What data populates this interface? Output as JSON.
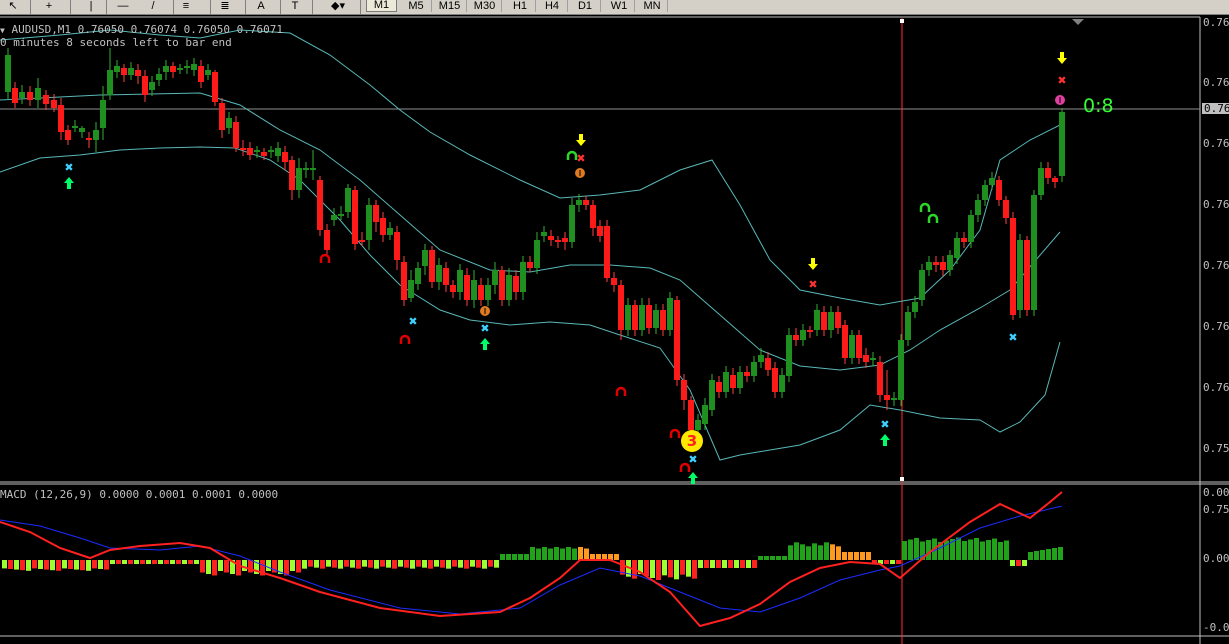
{
  "toolbar": {
    "tools": [
      {
        "name": "cursor-icon",
        "glyph": "↖"
      },
      {
        "name": "crosshair-icon",
        "glyph": "+"
      },
      {
        "name": "vertical-line-icon",
        "glyph": "|"
      },
      {
        "name": "horizontal-line-icon",
        "glyph": "—"
      },
      {
        "name": "trendline-icon",
        "glyph": "/"
      },
      {
        "name": "equidistant-channel-icon",
        "glyph": "≡"
      },
      {
        "name": "fibonacci-icon",
        "glyph": "≣"
      },
      {
        "name": "text-icon",
        "glyph": "A"
      },
      {
        "name": "text-label-icon",
        "glyph": "T"
      },
      {
        "name": "arrows-menu-icon",
        "glyph": "◆▾"
      }
    ],
    "timeframes": [
      "M1",
      "M5",
      "M15",
      "M30",
      "H1",
      "H4",
      "D1",
      "W1",
      "MN"
    ],
    "active_timeframe": "M1"
  },
  "main_chart": {
    "header": "AUDUSD,M1  0.76050 0.76074 0.76050 0.76071",
    "timer": "0 minutes 8 seconds left to bar end",
    "signal_score": "0:8",
    "count_badge": "3",
    "current_price_label": "0.76",
    "price_labels": [
      "0.76",
      "0.76",
      "0.76",
      "0.76",
      "0.76",
      "0.76",
      "0.76",
      "0.75",
      "0.75"
    ]
  },
  "macd": {
    "header": "MACD (12,26,9) 0.0000 0.0001 0.0001 0.0000",
    "levels": [
      "0.00",
      "0.00",
      "-0.00"
    ]
  },
  "colors": {
    "bull": "#1f8f1f",
    "bear": "#ff1a1a",
    "bands": "#59b8b8",
    "grid": "#c0c0c0",
    "signal_up": "#00ff66",
    "signal_down": "#ffff00",
    "hist_green": "#21a21a",
    "hist_red": "#ff2020",
    "hist_orange": "#ff9a20",
    "hist_lime": "#9cff30",
    "macd_line": "#ff2020",
    "signal_line": "#1c2cff"
  }
}
